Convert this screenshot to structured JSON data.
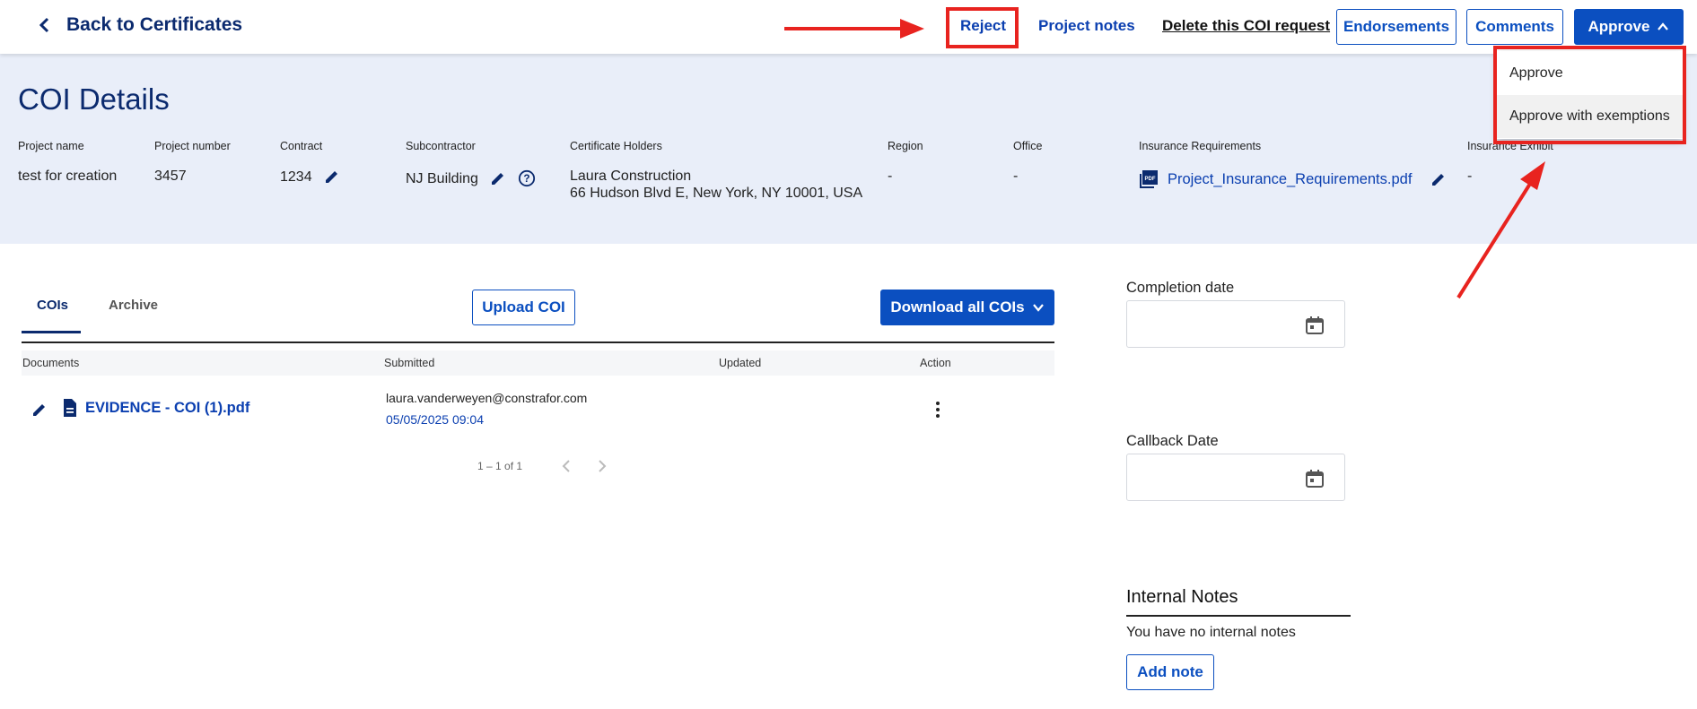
{
  "topbar": {
    "back_label": "Back to Certificates",
    "reject_label": "Reject",
    "project_notes_label": "Project notes",
    "delete_label": "Delete this COI request",
    "endorsements_label": "Endorsements",
    "comments_label": "Comments",
    "approve_label": "Approve"
  },
  "approve_menu": {
    "items": [
      "Approve",
      "Approve with exemptions"
    ]
  },
  "details": {
    "title": "COI Details",
    "fields": {
      "project_name": {
        "label": "Project name",
        "value": "test for creation"
      },
      "project_number": {
        "label": "Project number",
        "value": "3457"
      },
      "contract": {
        "label": "Contract",
        "value": "1234"
      },
      "subcontractor": {
        "label": "Subcontractor",
        "value": "NJ Building"
      },
      "certificate_holders": {
        "label": "Certificate Holders",
        "line1": "Laura Construction",
        "line2": "66 Hudson Blvd E, New York, NY 10001, USA"
      },
      "region": {
        "label": "Region",
        "value": "-"
      },
      "office": {
        "label": "Office",
        "value": "-"
      },
      "insurance_requirements": {
        "label": "Insurance Requirements",
        "value": "Project_Insurance_Requirements.pdf"
      },
      "insurance_exhibit": {
        "label": "Insurance Exhibit",
        "value": "-"
      }
    }
  },
  "tabs": [
    {
      "label": "COIs",
      "active": true
    },
    {
      "label": "Archive",
      "active": false
    }
  ],
  "upload_label": "Upload COI",
  "download_label": "Download all COIs",
  "table": {
    "headers": [
      "Documents",
      "Submitted",
      "Updated",
      "Action"
    ],
    "rows": [
      {
        "document": "EVIDENCE - COI (1).pdf",
        "submitted_by": "laura.vanderweyen@constrafor.com",
        "submitted_at": "05/05/2025 09:04",
        "updated": ""
      }
    ],
    "pagination": "1 – 1 of 1"
  },
  "right_panel": {
    "completion_label": "Completion date",
    "completion_value": "",
    "callback_label": "Callback Date",
    "callback_value": "",
    "notes_title": "Internal Notes",
    "notes_empty": "You have no internal notes",
    "add_note_label": "Add note"
  },
  "colors": {
    "primary": "#0b4fc0",
    "title_navy": "#0b2a6e",
    "band": "#e9eef9",
    "annotation_red": "#e8231f"
  }
}
